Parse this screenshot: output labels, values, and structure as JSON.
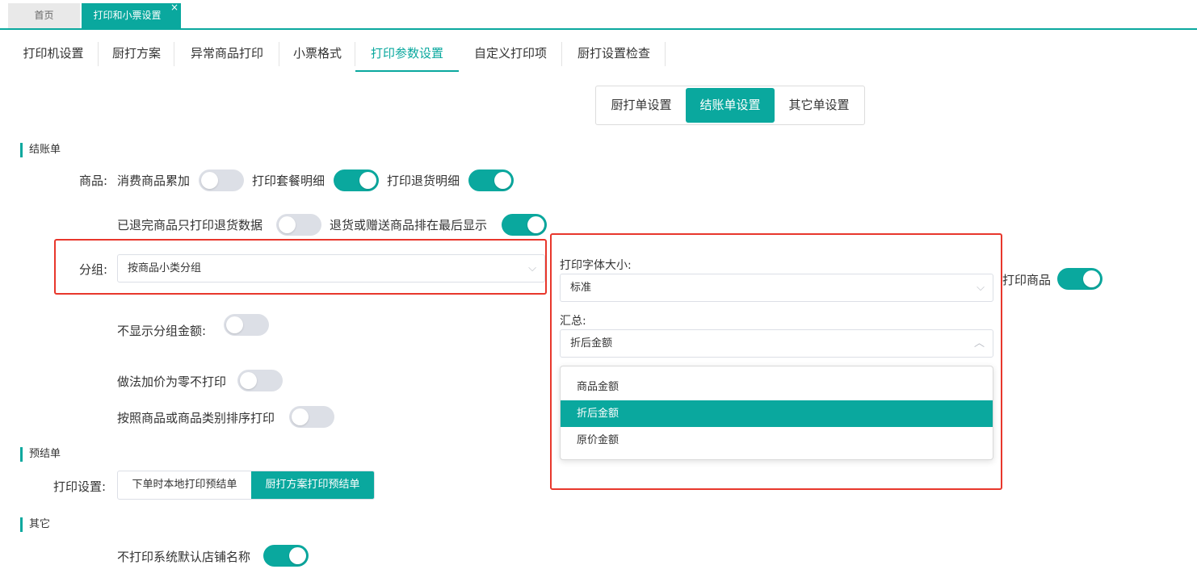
{
  "page_tabs": {
    "home": "首页",
    "active": "打印和小票设置",
    "close": "×"
  },
  "sub_tabs": [
    "打印机设置",
    "厨打方案",
    "异常商品打印",
    "小票格式",
    "打印参数设置",
    "自定义打印项",
    "厨打设置检查"
  ],
  "segment": {
    "kitchen": "厨打单设置",
    "checkout": "结账单设置",
    "other": "其它单设置"
  },
  "sections": {
    "checkout": "结账单",
    "pre_checkout": "预结单",
    "other": "其它"
  },
  "goods": {
    "label": "商品:",
    "accumulate": "消费商品累加",
    "accumulate_on": false,
    "combo_detail": "打印套餐明细",
    "combo_detail_on": true,
    "return_detail": "打印退货明细",
    "return_detail_on": true,
    "returned_only": "已退完商品只打印退货数据",
    "returned_only_on": false,
    "return_last": "退货或赠送商品排在最后显示",
    "return_last_on": true
  },
  "group": {
    "label": "分组:",
    "value": "按商品小类分组"
  },
  "font_size": {
    "label": "打印字体大小:",
    "value": "标准"
  },
  "summary": {
    "label": "汇总:",
    "value": "折后金额",
    "options": [
      "商品金额",
      "折后金额",
      "原价金额"
    ],
    "selected": "折后金额"
  },
  "print_goods": {
    "label": "打印商品",
    "on": true
  },
  "hide_group_amount": {
    "label": "不显示分组金额:",
    "on": false
  },
  "zero_price": {
    "label": "做法加价为零不打印",
    "on": false
  },
  "sort_print": {
    "label": "按照商品或商品类别排序打印",
    "on": false
  },
  "print_setting": {
    "label": "打印设置:",
    "local": "下单时本地打印预结单",
    "kitchen_plan": "厨打方案打印预结单"
  },
  "no_store_name": {
    "label": "不打印系统默认店铺名称",
    "on": true
  },
  "icons": {
    "chevron_down": "⌵",
    "chevron_up": "︿"
  },
  "colors": {
    "accent": "#0aa89e",
    "highlight": "#e8372c"
  }
}
